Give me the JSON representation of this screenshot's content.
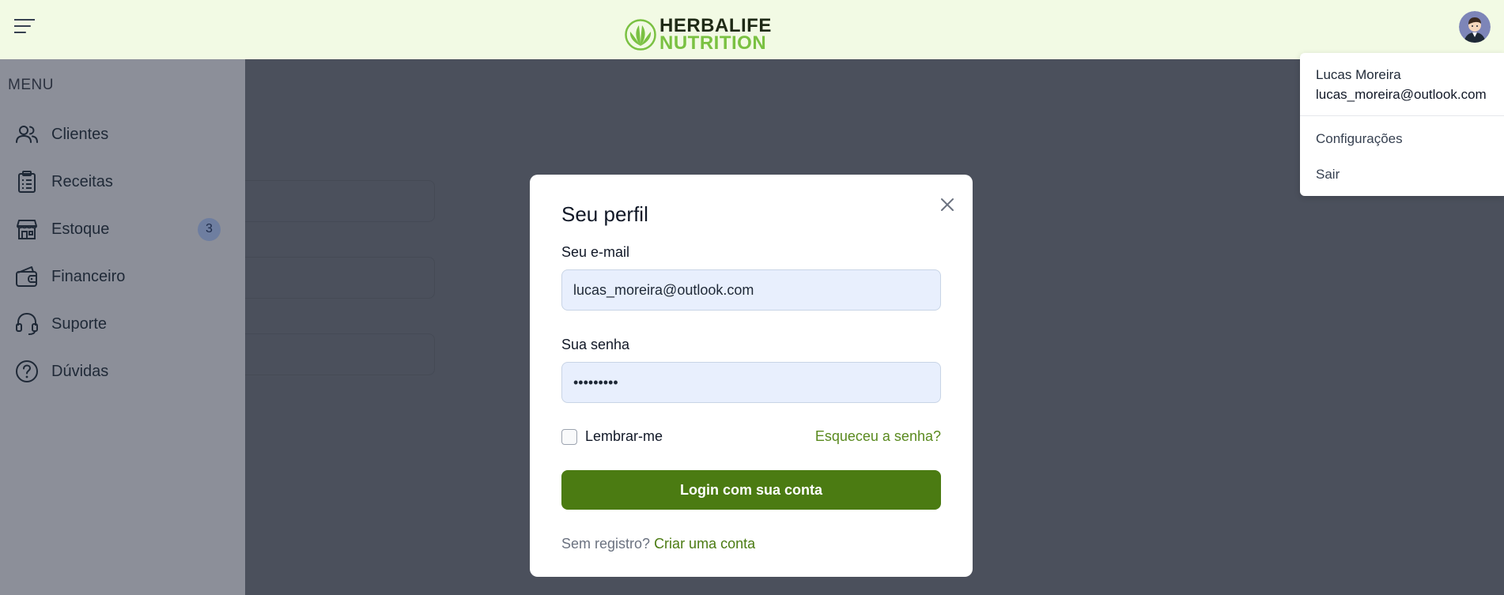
{
  "header": {
    "logo_line1": "HERBALIFE",
    "logo_line2": "NUTRITION",
    "menu_icon": "hamburger-icon",
    "avatar_icon": "user-avatar-icon"
  },
  "sidebar": {
    "title": "MENU",
    "items": [
      {
        "label": "Clientes",
        "icon": "users-icon"
      },
      {
        "label": "Receitas",
        "icon": "clipboard-icon"
      },
      {
        "label": "Estoque",
        "icon": "store-icon",
        "badge": "3"
      },
      {
        "label": "Financeiro",
        "icon": "wallet-icon"
      },
      {
        "label": "Suporte",
        "icon": "headset-icon"
      },
      {
        "label": "Dúvidas",
        "icon": "question-icon"
      }
    ]
  },
  "modal": {
    "title": "Seu perfil",
    "email_label": "Seu e-mail",
    "email_value": "lucas_moreira@outlook.com",
    "password_label": "Sua senha",
    "password_value": "•••••••••",
    "remember_label": "Lembrar-me",
    "forgot_label": "Esqueceu a senha?",
    "login_button": "Login com sua conta",
    "signup_question": "Sem registro?",
    "signup_link": "Criar uma conta"
  },
  "user_menu": {
    "name": "Lucas Moreira",
    "email": "lucas_moreira@outlook.com",
    "settings": "Configurações",
    "logout": "Sair"
  },
  "colors": {
    "brand_green": "#4b7b12",
    "link_green": "#5a8a1f",
    "header_bg": "#f2fae4",
    "overlay": "#4b505c"
  }
}
